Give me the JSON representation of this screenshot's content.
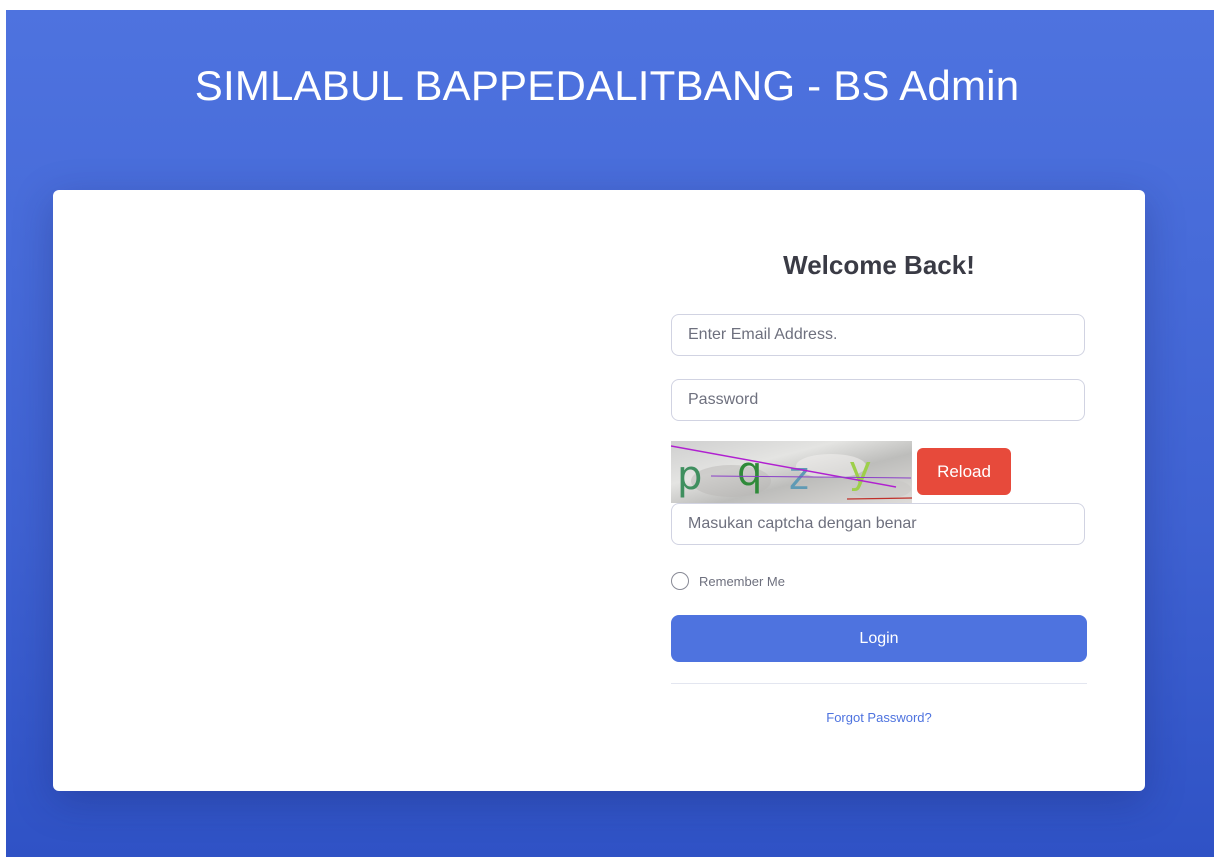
{
  "app": {
    "title": "SIMLABUL BAPPEDALITBANG - BS Admin"
  },
  "login": {
    "heading": "Welcome Back!",
    "email_placeholder": "Enter Email Address.",
    "password_placeholder": "Password",
    "captcha": {
      "text": [
        "p",
        "q",
        "z",
        "y"
      ],
      "letter_colors": [
        "#3f8f5f",
        "#2f8a3a",
        "#5f9ab5",
        "#9dcf4a"
      ],
      "reload_label": "Reload"
    },
    "captcha_placeholder": "Masukan captcha dengan benar",
    "remember_label": "Remember Me",
    "login_label": "Login",
    "forgot_label": "Forgot Password?"
  },
  "colors": {
    "primary": "#4e73df",
    "danger": "#e74a3b",
    "text": "#3a3b45",
    "muted": "#6e707e"
  }
}
